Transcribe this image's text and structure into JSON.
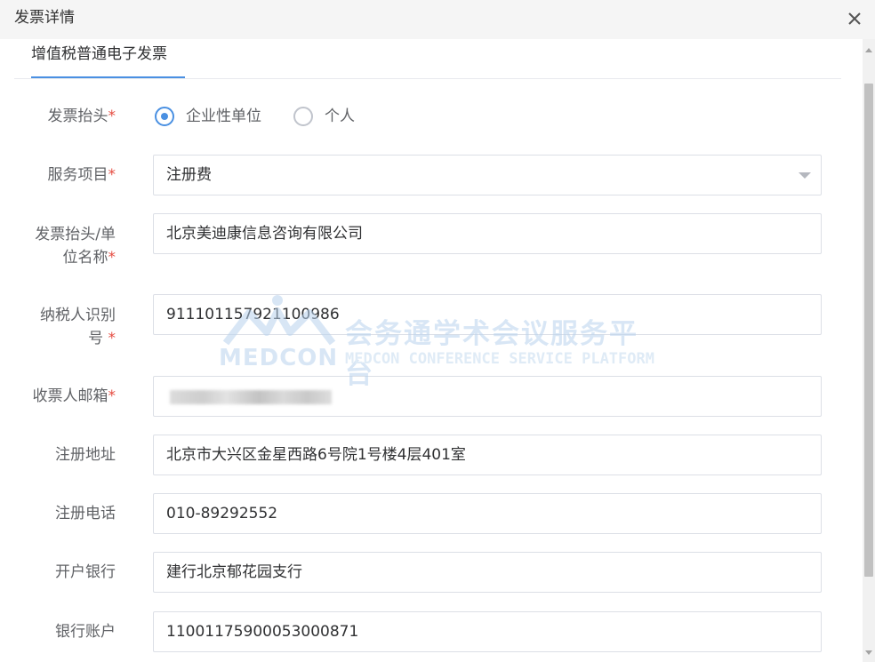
{
  "dialog": {
    "title": "发票详情"
  },
  "tabs": [
    {
      "label": "增值税普通电子发票",
      "active": true
    }
  ],
  "form": {
    "required_mark": "*",
    "invoice_header": {
      "label": "发票抬头",
      "options": [
        {
          "label": "企业性单位",
          "checked": true
        },
        {
          "label": "个人",
          "checked": false
        }
      ]
    },
    "service_item": {
      "label": "服务项目",
      "value": "注册费"
    },
    "company_name": {
      "label_line1": "发票抬头/单",
      "label_line2": "位名称",
      "value": "北京美迪康信息咨询有限公司"
    },
    "taxpayer_id": {
      "label_line1": "纳税人识别",
      "label_line2": "号",
      "value": "911101157921100986"
    },
    "recipient_email": {
      "label": "收票人邮箱"
    },
    "registered_address": {
      "label": "注册地址",
      "value": "北京市大兴区金星西路6号院1号楼4层401室"
    },
    "registered_phone": {
      "label": "注册电话",
      "value": "010-89292552"
    },
    "bank": {
      "label": "开户银行",
      "value": "建行北京郁花园支行"
    },
    "bank_account": {
      "label": "银行账户",
      "value": "11001175900053000871"
    }
  },
  "watermark": {
    "logo_text": "MEDCON",
    "title_cn": "会务通学术会议服务平台",
    "title_en": "MEDCON CONFERENCE SERVICE PLATFORM"
  },
  "colors": {
    "accent": "#4a90e2",
    "required": "#e54d42",
    "header_bg": "#f5f5f5",
    "border": "#dcdfe6"
  }
}
